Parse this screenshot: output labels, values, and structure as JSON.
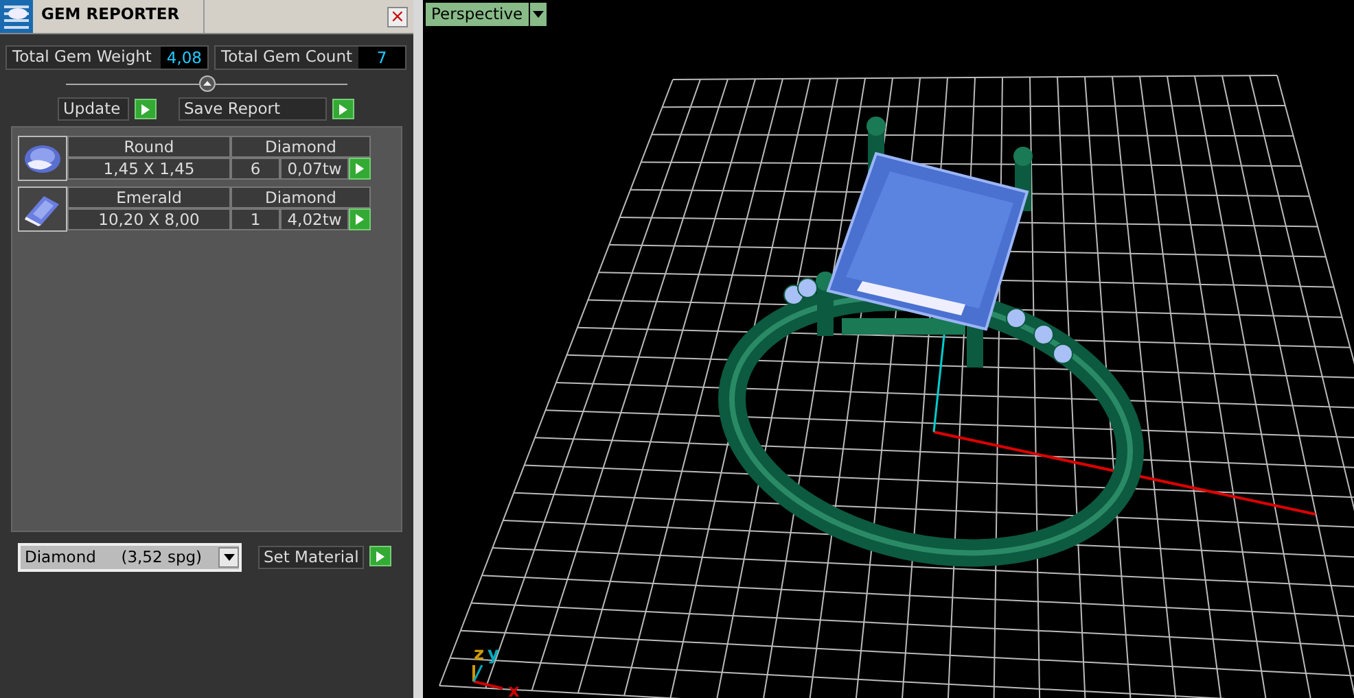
{
  "panel": {
    "title": "GEM REPORTER",
    "close": "×"
  },
  "totals": [
    {
      "label": "Total Gem Weight",
      "value": "4,08"
    },
    {
      "label": "Total Gem Count",
      "value": "7"
    }
  ],
  "actions": [
    {
      "label": "Update"
    },
    {
      "label": "Save Report"
    }
  ],
  "gems": [
    {
      "kind": "round",
      "cut": "Round",
      "material": "Diamond",
      "size": "1,45 X 1,45",
      "count": "6",
      "weight": "0,07tw"
    },
    {
      "kind": "emerald",
      "cut": "Emerald",
      "material": "Diamond",
      "size": "10,20 X 8,00",
      "count": "1",
      "weight": "4,02tw"
    }
  ],
  "material_select": {
    "value": "Diamond     (3,52 spg)"
  },
  "set_material": {
    "label": "Set Material"
  },
  "viewport": {
    "view": "Perspective",
    "axes": [
      "x",
      "y",
      "z"
    ]
  }
}
